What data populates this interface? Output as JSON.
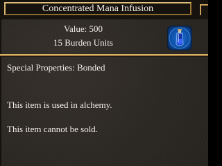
{
  "window": {
    "title": "Concentrated Mana Infusion"
  },
  "item": {
    "value_text": "Value: 500",
    "burden_text": "15 Burden Units",
    "icon": "mana-potion-icon",
    "special_properties": "Special Properties: Bonded",
    "alchemy_note": "This item is used in alchemy.",
    "sell_note": "This item cannot be sold."
  },
  "colors": {
    "accent_gold": "#c9a15a",
    "text": "#f2eee6",
    "panel_background": "#2d2924",
    "icon_blue": "#0e4fa8"
  }
}
